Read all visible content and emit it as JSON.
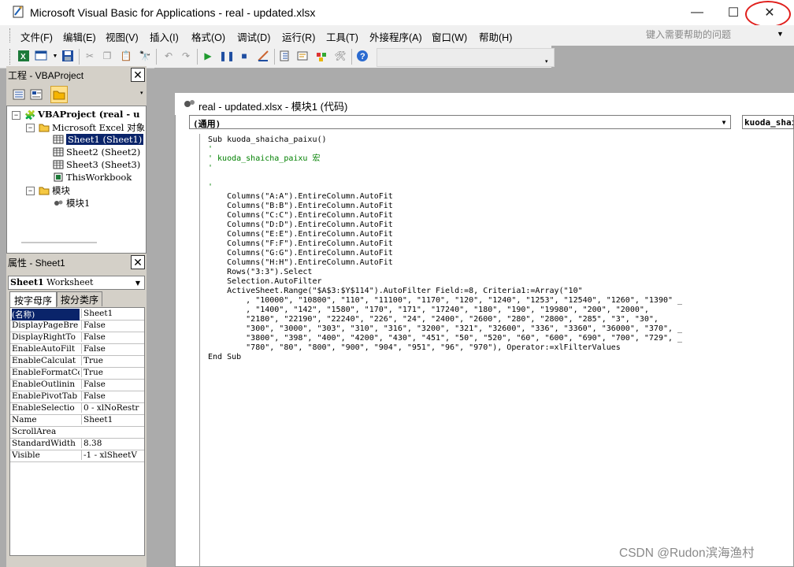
{
  "window": {
    "title": "Microsoft Visual Basic for Applications - real - updated.xlsx",
    "minimize_glyph": "—",
    "maximize_glyph": "☐",
    "close_glyph": "✕"
  },
  "menu": {
    "items": [
      "文件(F)",
      "编辑(E)",
      "视图(V)",
      "插入(I)",
      "格式(O)",
      "调试(D)",
      "运行(R)",
      "工具(T)",
      "外接程序(A)",
      "窗口(W)",
      "帮助(H)"
    ],
    "help_search_placeholder": "键入需要帮助的问题"
  },
  "toolbar": {
    "icons": [
      "excel-icon",
      "insert-userform-icon",
      "save-icon",
      "cut-icon",
      "copy-icon",
      "paste-icon",
      "find-icon",
      "undo-icon",
      "redo-icon",
      "run-icon",
      "break-icon",
      "reset-icon",
      "design-mode-icon",
      "project-explorer-icon",
      "properties-icon",
      "object-browser-icon",
      "toolbox-icon",
      "help-icon"
    ]
  },
  "project_pane": {
    "title": "工程 - VBAProject",
    "tree": [
      {
        "label": "VBAProject (real - u",
        "bold": true
      },
      {
        "label": "Microsoft Excel 对象"
      },
      {
        "label": "Sheet1 (Sheet1)",
        "selected": true
      },
      {
        "label": "Sheet2 (Sheet2)"
      },
      {
        "label": "Sheet3 (Sheet3)"
      },
      {
        "label": "ThisWorkbook"
      },
      {
        "label": "模块"
      },
      {
        "label": "模块1"
      }
    ]
  },
  "properties_pane": {
    "title": "属性 - Sheet1",
    "object_combo_bold": "Sheet1",
    "object_combo_rest": " Worksheet",
    "tabs": [
      "按字母序",
      "按分类序"
    ],
    "rows": [
      {
        "name": "(名称)",
        "value": "Sheet1"
      },
      {
        "name": "DisplayPageBre",
        "value": "False"
      },
      {
        "name": "DisplayRightTo",
        "value": "False"
      },
      {
        "name": "EnableAutoFilt",
        "value": "False"
      },
      {
        "name": "EnableCalculat",
        "value": "True"
      },
      {
        "name": "EnableFormatCo",
        "value": "True"
      },
      {
        "name": "EnableOutlinin",
        "value": "False"
      },
      {
        "name": "EnablePivotTab",
        "value": "False"
      },
      {
        "name": "EnableSelectio",
        "value": "0 - xlNoRestr"
      },
      {
        "name": "Name",
        "value": "Sheet1"
      },
      {
        "name": "ScrollArea",
        "value": ""
      },
      {
        "name": "StandardWidth",
        "value": "8.38"
      },
      {
        "name": "Visible",
        "value": "-1 - xlSheetV"
      }
    ]
  },
  "code_window": {
    "title": "real - updated.xlsx - 模块1 (代码)",
    "object_combo": "(通用)",
    "proc_combo": "kuoda_shaicha_paixu",
    "lines": [
      {
        "text": "Sub kuoda_shaicha_paixu()",
        "color": "black"
      },
      {
        "text": "'",
        "color": "green"
      },
      {
        "text": "' kuoda_shaicha_paixu 宏",
        "color": "green"
      },
      {
        "text": "'",
        "color": "green"
      },
      {
        "text": "",
        "color": "black"
      },
      {
        "text": "'",
        "color": "green"
      },
      {
        "text": "    Columns(\"A:A\").EntireColumn.AutoFit",
        "color": "black"
      },
      {
        "text": "    Columns(\"B:B\").EntireColumn.AutoFit",
        "color": "black"
      },
      {
        "text": "    Columns(\"C:C\").EntireColumn.AutoFit",
        "color": "black"
      },
      {
        "text": "    Columns(\"D:D\").EntireColumn.AutoFit",
        "color": "black"
      },
      {
        "text": "    Columns(\"E:E\").EntireColumn.AutoFit",
        "color": "black"
      },
      {
        "text": "    Columns(\"F:F\").EntireColumn.AutoFit",
        "color": "black"
      },
      {
        "text": "    Columns(\"G:G\").EntireColumn.AutoFit",
        "color": "black"
      },
      {
        "text": "    Columns(\"H:H\").EntireColumn.AutoFit",
        "color": "black"
      },
      {
        "text": "    Rows(\"3:3\").Select",
        "color": "black"
      },
      {
        "text": "    Selection.AutoFilter",
        "color": "black"
      },
      {
        "text": "    ActiveSheet.Range(\"$A$3:$Y$114\").AutoFilter Field:=8, Criteria1:=Array(\"10\"",
        "color": "black"
      },
      {
        "text": "        , \"10000\", \"10800\", \"110\", \"11100\", \"1170\", \"120\", \"1240\", \"1253\", \"12540\", \"1260\", \"1390\" _",
        "color": "black"
      },
      {
        "text": "        , \"1400\", \"142\", \"1580\", \"170\", \"171\", \"17240\", \"180\", \"190\", \"19980\", \"200\", \"2000\",",
        "color": "black"
      },
      {
        "text": "        \"2180\", \"22190\", \"22240\", \"226\", \"24\", \"2400\", \"2600\", \"280\", \"2800\", \"285\", \"3\", \"30\",",
        "color": "black"
      },
      {
        "text": "        \"300\", \"3000\", \"303\", \"310\", \"316\", \"3200\", \"321\", \"32600\", \"336\", \"3360\", \"36000\", \"370\", _",
        "color": "black"
      },
      {
        "text": "        \"3800\", \"398\", \"400\", \"4200\", \"430\", \"451\", \"50\", \"520\", \"60\", \"600\", \"690\", \"700\", \"729\", _",
        "color": "black"
      },
      {
        "text": "        \"780\", \"80\", \"800\", \"900\", \"904\", \"951\", \"96\", \"970\"), Operator:=xlFilterValues",
        "color": "black"
      },
      {
        "text": "End Sub",
        "color": "black"
      }
    ]
  },
  "watermark": "CSDN @Rudon滨海渔村",
  "colors": {
    "selection": "#0a246a",
    "comment": "#008000",
    "close_highlight": "#e0201d",
    "mdi_background": "#ababab"
  }
}
